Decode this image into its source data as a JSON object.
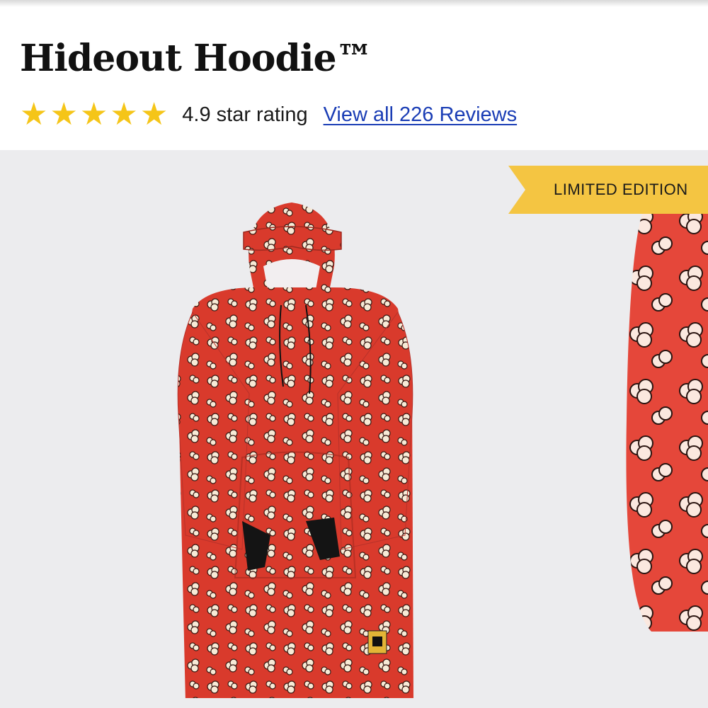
{
  "product": {
    "title": "Hideout Hoodie™",
    "rating_value": 4.9,
    "rating_text": "4.9 star rating",
    "stars": [
      "★",
      "★",
      "★",
      "★",
      "★"
    ],
    "reviews_link": "View all 226 Reviews"
  },
  "gallery": {
    "badge": "LIMITED EDITION",
    "badge_color": "#f4c542",
    "main_image": "red popcorn-print hoodie blanket with hood eye mask",
    "next_image": "close-up of red popcorn-print fabric"
  },
  "colors": {
    "star": "#f5c518",
    "link": "#1a3db5",
    "hoodie": "#d93a2c",
    "gallery_bg": "#ececee"
  }
}
